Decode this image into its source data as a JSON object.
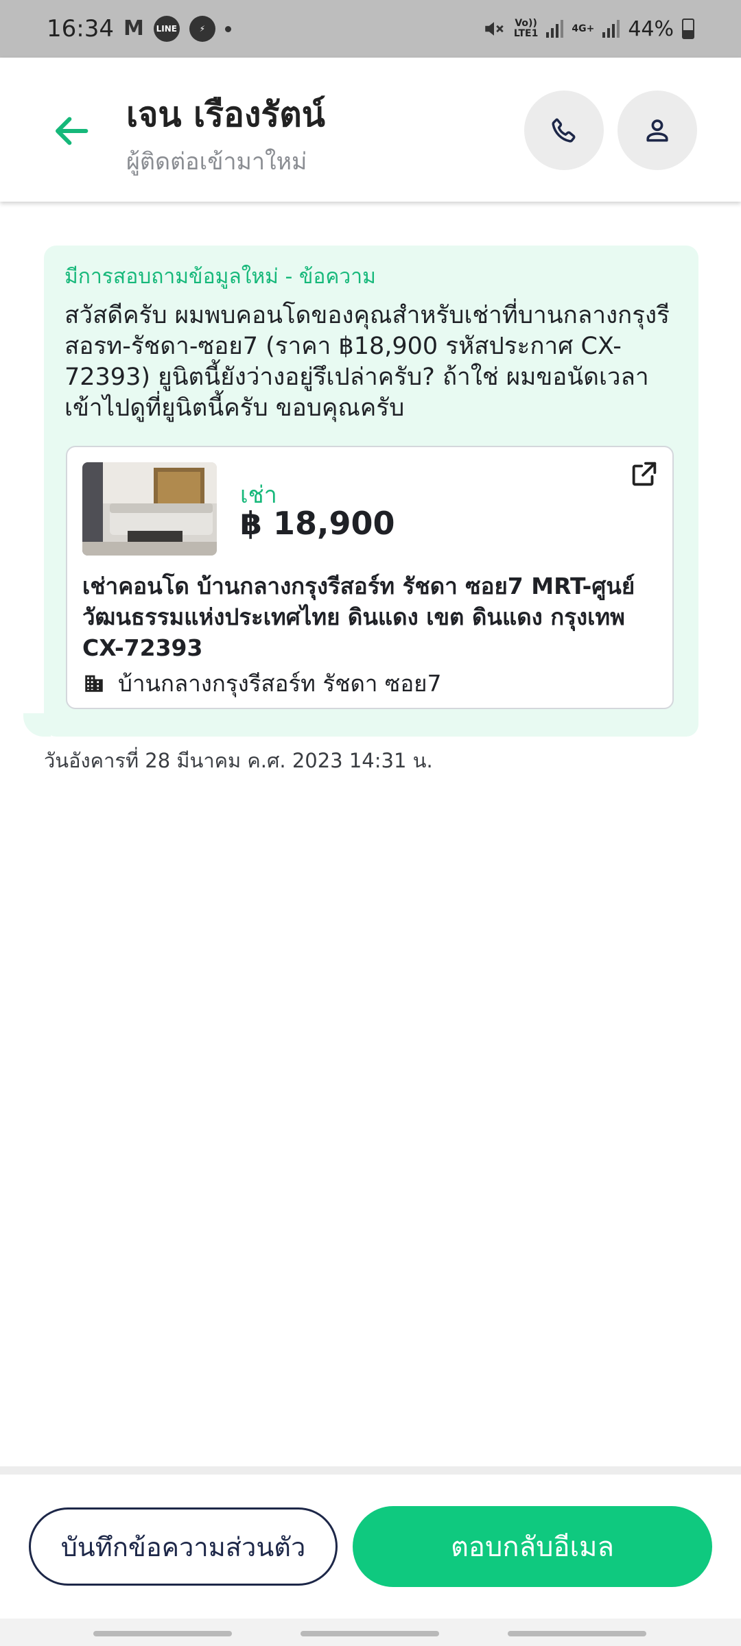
{
  "status_bar": {
    "time": "16:34",
    "network_1": "Vo))\nLTE1",
    "network_2": "4G+",
    "battery": "44%"
  },
  "header": {
    "title": "เจน เรืองรัตน์",
    "subtitle": "ผู้ติดต่อเข้ามาใหม่"
  },
  "message": {
    "heading": "มีการสอบถามข้อมูลใหม่ - ข้อความ",
    "body": "สวัสดีครับ ผมพบคอนโดของคุณสำหรับเช่าที่บานกลางกรุงรีสอรท-รัชดา-ซอย7 (ราคา ฿18,900 รหัสประกาศ CX-72393) ยูนิตนี้ยังว่างอยู่รึเปล่าครับ? ถ้าใช่ ผมขอนัดเวลาเข้าไปดูที่ยูนิตนี้ครับ ขอบคุณครับ",
    "timestamp": "วันอังคารที่ 28 มีนาคม ค.ศ. 2023 14:31 น."
  },
  "listing": {
    "type": "เช่า",
    "price": "฿ 18,900",
    "title": "เช่าคอนโด บ้านกลางกรุงรีสอร์ท รัชดา ซอย7 MRT-ศูนย์วัฒนธรรมแห่งประเทศไทย ดินแดง เขต ดินแดง กรุงเทพ CX-72393",
    "building": "บ้านกลางกรุงรีสอร์ท รัชดา ซอย7"
  },
  "actions": {
    "note_label": "บันทึกข้อความส่วนตัว",
    "reply_label": "ตอบกลับอีเมล"
  },
  "colors": {
    "accent": "#0fc97f",
    "accent_text": "#16b87a",
    "bubble_bg": "#e8faf2",
    "navy": "#1d2748"
  },
  "icons": {
    "back": "arrow-left-icon",
    "call": "phone-icon",
    "contact": "person-icon",
    "external": "external-link-icon",
    "building": "building-icon"
  }
}
